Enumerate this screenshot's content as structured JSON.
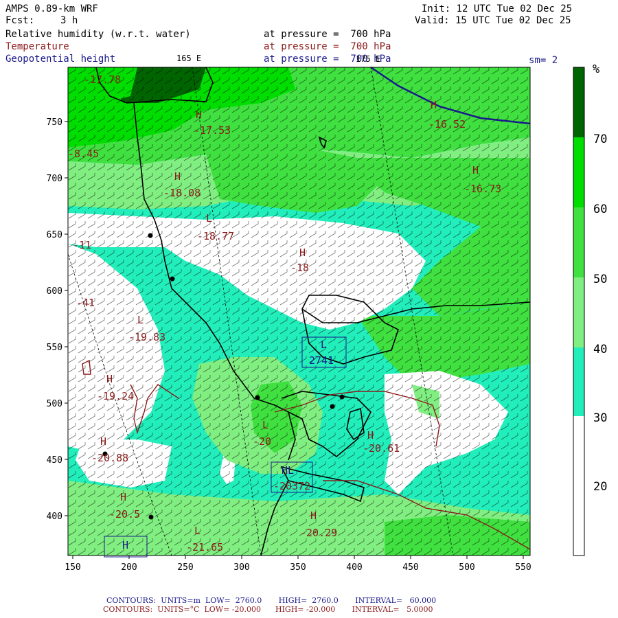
{
  "header": {
    "model": "AMPS 0.89-km WRF",
    "fcst_label": "Fcst:",
    "fcst_value": "3 h",
    "init": "Init: 12 UTC Tue 02 Dec 25",
    "valid": "Valid: 15 UTC Tue 02 Dec 25",
    "fields": [
      {
        "name": "Relative humidity (w.r.t. water)",
        "level": "at pressure =  700 hPa",
        "color": "#000000"
      },
      {
        "name": "Temperature",
        "level": "at pressure =  700 hPa",
        "color": "#8b1a1a"
      },
      {
        "name": "Geopotential height",
        "level": "at pressure =  700 hPa",
        "color": "#1a1a8b"
      }
    ],
    "sm": "sm= 2",
    "lon_labels": [
      "165 E",
      "175 E"
    ]
  },
  "axes": {
    "x_ticks": [
      "150",
      "200",
      "250",
      "300",
      "350",
      "400",
      "450",
      "500",
      "550"
    ],
    "y_ticks": [
      "750",
      "700",
      "650",
      "600",
      "550",
      "500",
      "450",
      "400"
    ]
  },
  "colorbar": {
    "unit": "%",
    "labels": [
      "70",
      "60",
      "50",
      "40",
      "30",
      "20"
    ],
    "colors": [
      "#006400",
      "#00dd00",
      "#3fe03f",
      "#80ee80",
      "#22eebb",
      "#ffffff"
    ]
  },
  "map_labels": [
    {
      "text": "-17.78",
      "kind": "value"
    },
    {
      "text": "H",
      "kind": "H"
    },
    {
      "text": "-17.53",
      "kind": "value"
    },
    {
      "text": "H",
      "kind": "H"
    },
    {
      "text": "-16.52",
      "kind": "value"
    },
    {
      "text": "-8.45",
      "kind": "value"
    },
    {
      "text": "H",
      "kind": "H"
    },
    {
      "text": "-18.08",
      "kind": "value"
    },
    {
      "text": "H",
      "kind": "H"
    },
    {
      "text": "-16.73",
      "kind": "value"
    },
    {
      "text": "L",
      "kind": "L"
    },
    {
      "text": "-18.77",
      "kind": "value"
    },
    {
      "text": "-11",
      "kind": "value"
    },
    {
      "text": "H",
      "kind": "H"
    },
    {
      "text": "-18",
      "kind": "value"
    },
    {
      "text": "-41",
      "kind": "value"
    },
    {
      "text": "L",
      "kind": "L"
    },
    {
      "text": "-19.83",
      "kind": "value"
    },
    {
      "text": "H",
      "kind": "H"
    },
    {
      "text": "-19.24",
      "kind": "value"
    },
    {
      "text": "L",
      "kind": "L"
    },
    {
      "text": "-20",
      "kind": "value"
    },
    {
      "text": "H",
      "kind": "H"
    },
    {
      "text": "-20.61",
      "kind": "value"
    },
    {
      "text": "H",
      "kind": "H"
    },
    {
      "text": "-20.88",
      "kind": "value"
    },
    {
      "text": "H",
      "kind": "H"
    },
    {
      "text": "-20.5",
      "kind": "value"
    },
    {
      "text": "H",
      "kind": "H"
    },
    {
      "text": "-20.29",
      "kind": "value"
    },
    {
      "text": "L",
      "kind": "L"
    },
    {
      "text": "-21.65",
      "kind": "value"
    }
  ],
  "boxed_labels": [
    {
      "letter": "L",
      "value": "2741"
    },
    {
      "letter": "HL",
      "value": "-20372"
    },
    {
      "letter": "H",
      "value": ""
    }
  ],
  "footer": [
    {
      "text": "CONTOURS:  UNITS=m  LOW=  2760.0       HIGH=  2760.0       INTERVAL=   60.000",
      "color": "#1a1a8b"
    },
    {
      "text": "CONTOURS:  UNITS=°C  LOW= -20.000      HIGH= -20.000       INTERVAL=   5.0000",
      "color": "#8b1a1a"
    }
  ]
}
